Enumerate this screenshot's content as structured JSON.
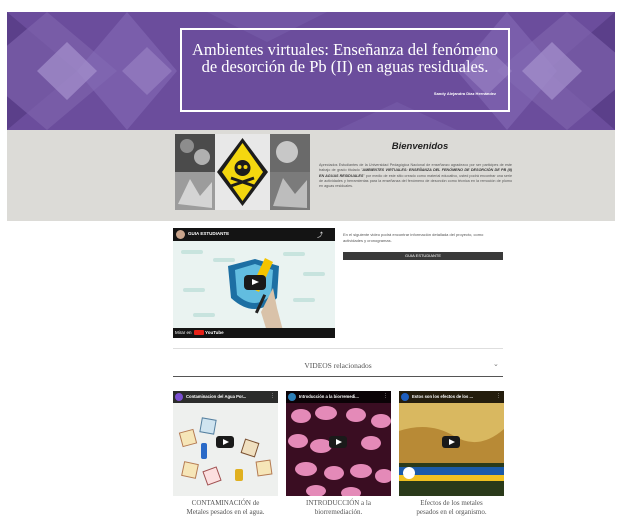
{
  "hero": {
    "title_line1": "Ambientes virtuales: Enseñanza del fenómeno",
    "title_line2": "de desorción de Pb (II) en aguas residuales.",
    "author": "Sandy Alejandra Díaz Hernández",
    "colors": {
      "background": "#6b4d9c",
      "frame": "#ffffff"
    }
  },
  "welcome": {
    "title": "Bienvenidos",
    "text_part1": "Apreciados Estudiantes de la Universidad Pedagógica Nacional de enseñanzo agradezco por ser participes de este trabajo de grado titulado \"",
    "text_bold": "AMBIENTES VIRTUALES: ENSEÑANZA DEL FENÓMENO DE DESORCIÓN DE PB (II) EN AGUAS RESIDUALES",
    "text_part2": "\" por medio de este sitio creado como material educativo, usted podrá encontrar una serie de actividades y herramientas para la enseñanza del fenómeno de desorción como técnica en la remoción de plomo en aguas residuales.",
    "background": "#dcdbd7"
  },
  "main_video": {
    "title": "GUIA ESTUDIANTE",
    "watch_on": "Mirar en",
    "yt_label": "YouTube"
  },
  "guide": {
    "text": "En el siguiente video podrá encontrar información detallada del proyecto, como actividades y cronogramas.",
    "button_label": "GUIA ESTUDIANTE"
  },
  "related": {
    "title": "VIDEOS relacionados",
    "videos": [
      {
        "title": "Contaminacion del Agua Por...",
        "caption_line1": "CONTAMINACIÓN de",
        "caption_line2": "Metales pesados en el agua."
      },
      {
        "title": "Introducción a la biorremedi...",
        "caption_line1": "INTRODUCCIÓN a la",
        "caption_line2": "biorremediación."
      },
      {
        "title": "Estos son los efectos de los ...",
        "caption_line1": "Efectos de los metales",
        "caption_line2": "pesados en el organismo."
      }
    ]
  }
}
